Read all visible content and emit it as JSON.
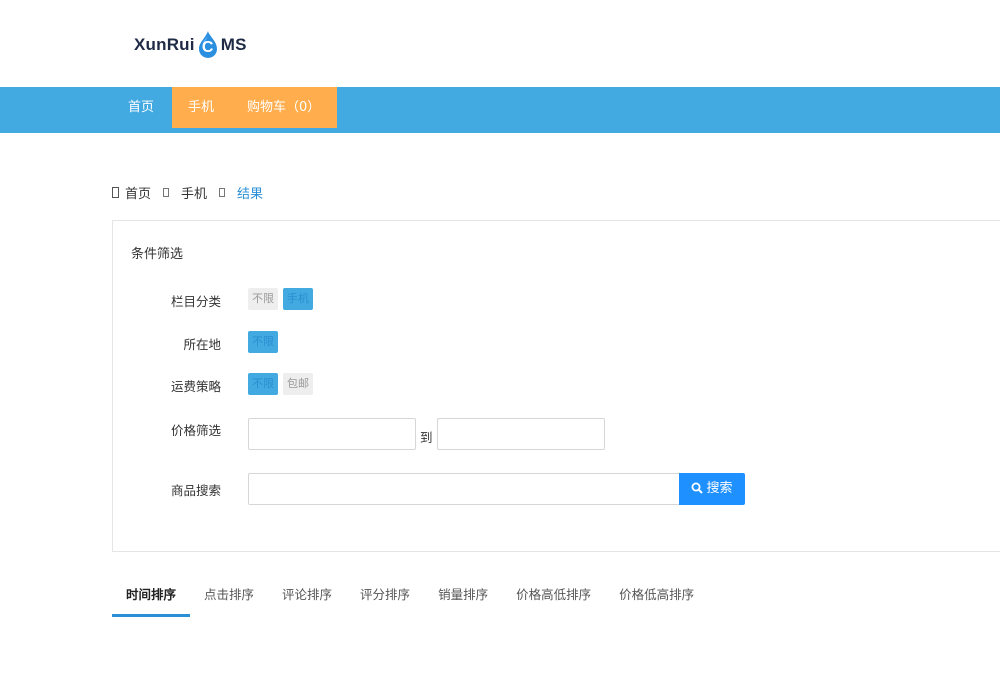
{
  "logo": {
    "prefix": "XunRui",
    "drop_letter": "C",
    "suffix": "MS"
  },
  "nav": {
    "home": "首页",
    "phone": "手机",
    "cart": "购物车（0）"
  },
  "breadcrumb": {
    "home": "首页",
    "category": "手机",
    "current": "结果"
  },
  "filter": {
    "title": "条件筛选",
    "rows": {
      "category": {
        "label": "栏目分类",
        "options": [
          "不限",
          "手机"
        ],
        "selected": "手机"
      },
      "location": {
        "label": "所在地",
        "options": [
          "不限"
        ],
        "selected": "不限"
      },
      "shipping": {
        "label": "运费策略",
        "options": [
          "不限",
          "包邮"
        ],
        "selected": "不限"
      }
    },
    "price": {
      "label": "价格筛选",
      "to_label": "到",
      "min_value": "",
      "max_value": ""
    },
    "search": {
      "label": "商品搜索",
      "value": "",
      "button_label": "搜索"
    }
  },
  "sort_tabs": [
    "时间排序",
    "点击排序",
    "评论排序",
    "评分排序",
    "销量排序",
    "价格高低排序",
    "价格低高排序"
  ],
  "sort_active": "时间排序",
  "colors": {
    "nav_blue": "#42a9e1",
    "nav_orange": "#ffad4d",
    "accent": "#1e90ff"
  }
}
